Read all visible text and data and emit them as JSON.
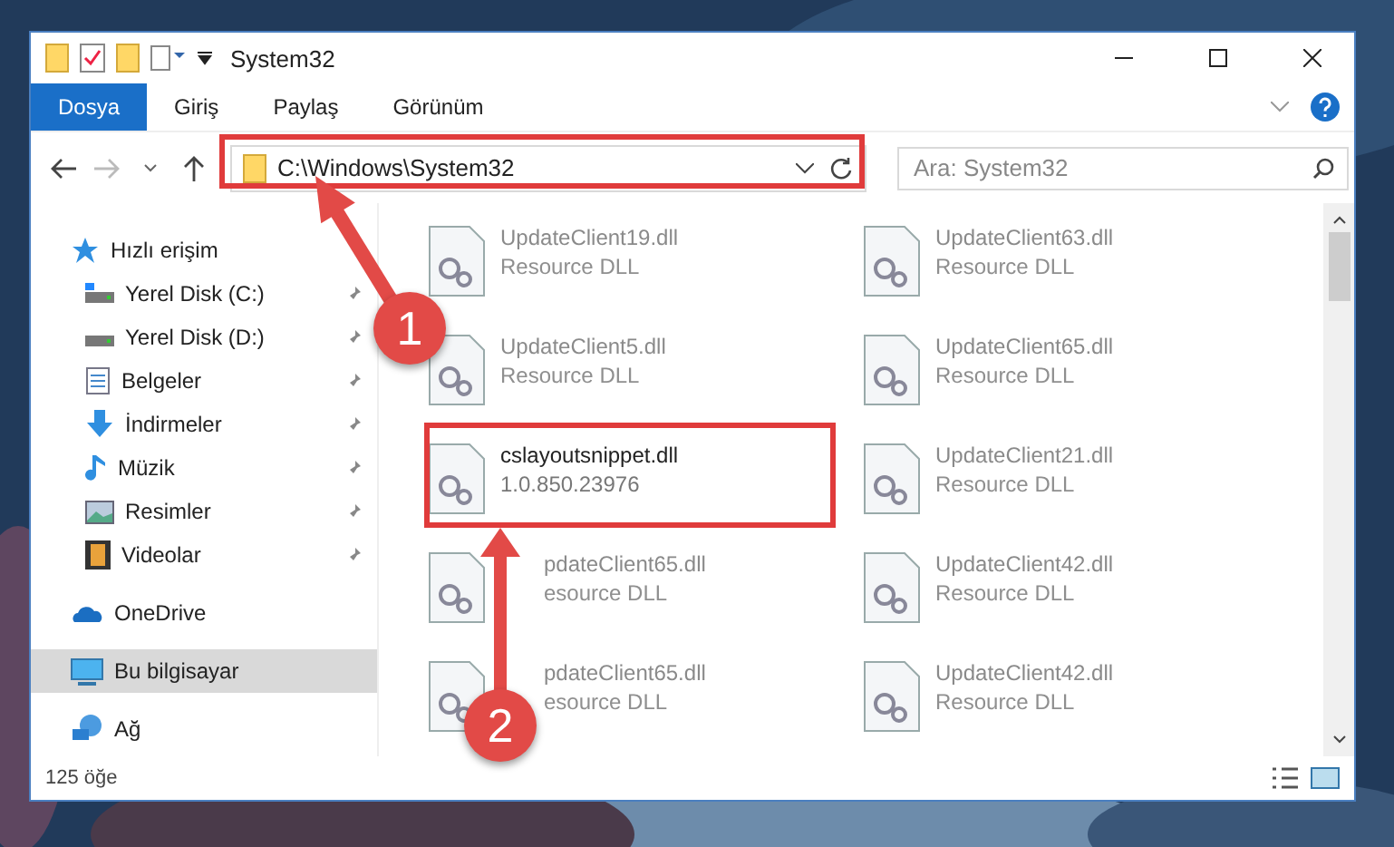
{
  "window": {
    "title": "System32"
  },
  "ribbon_tabs": [
    {
      "label": "Dosya",
      "selected": true
    },
    {
      "label": "Giriş",
      "selected": false
    },
    {
      "label": "Paylaş",
      "selected": false
    },
    {
      "label": "Görünüm",
      "selected": false
    }
  ],
  "address": {
    "value": "C:\\Windows\\System32"
  },
  "search": {
    "placeholder": "Ara: System32"
  },
  "sidebar": {
    "items": [
      {
        "label": "Hızlı erişim",
        "selected": false,
        "children": [
          {
            "label": "Yerel Disk (C:)",
            "pinned": true
          },
          {
            "label": "Yerel Disk (D:)",
            "pinned": true
          },
          {
            "label": "Belgeler",
            "pinned": true
          },
          {
            "label": "İndirmeler",
            "pinned": true
          },
          {
            "label": "Müzik",
            "pinned": true
          },
          {
            "label": "Resimler",
            "pinned": true
          },
          {
            "label": "Videolar",
            "pinned": true
          }
        ]
      },
      {
        "label": "OneDrive",
        "selected": false
      },
      {
        "label": "Bu bilgisayar",
        "selected": true
      },
      {
        "label": "Ağ",
        "selected": false
      }
    ]
  },
  "files": [
    {
      "name": "UpdateClient19.dll",
      "detail": "Resource DLL",
      "highlighted": false
    },
    {
      "name": "UpdateClient63.dll",
      "detail": "Resource DLL",
      "highlighted": false
    },
    {
      "name": "UpdateClient5.dll",
      "detail": "Resource DLL",
      "highlighted": false
    },
    {
      "name": "UpdateClient65.dll",
      "detail": "Resource DLL",
      "highlighted": false
    },
    {
      "name": "cslayoutsnippet.dll",
      "detail": "1.0.850.23976",
      "highlighted": true
    },
    {
      "name": "UpdateClient21.dll",
      "detail": "Resource DLL",
      "highlighted": false
    },
    {
      "name": "pdateClient65.dll",
      "detail": "esource DLL",
      "highlighted": false,
      "kind": "covered"
    },
    {
      "name": "UpdateClient42.dll",
      "detail": "Resource DLL",
      "highlighted": false
    },
    {
      "name": "pdateClient65.dll",
      "detail": "esource DLL",
      "highlighted": false,
      "kind": "covered"
    },
    {
      "name": "UpdateClient42.dll",
      "detail": "Resource DLL",
      "highlighted": false
    }
  ],
  "status_bar": {
    "count": "125 öğe"
  },
  "annotations": [
    {
      "label": "1"
    },
    {
      "label": "2"
    }
  ]
}
